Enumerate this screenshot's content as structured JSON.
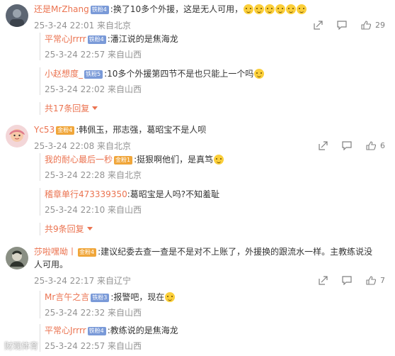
{
  "comments": [
    {
      "user": "还是MrZhang",
      "badge": "铁粉4",
      "text": ":换了10多个外援，这是无人可用，",
      "meta": "25-3-24 22:01 来自北京",
      "like_count": "29",
      "replies": [
        {
          "user": "平常心Jrrrr",
          "badge": "铁粉4",
          "text": ":潘江说的是焦海龙",
          "meta": "25-3-24 22:57 来自山西"
        },
        {
          "user": "小赵想度_",
          "badge": "铁粉5",
          "text": ":10多个外援第四节不是也只能上一个吗",
          "meta": "25-3-24 22:02 来自山西"
        }
      ],
      "more_label": "共17条回复"
    },
    {
      "user": "Yc53",
      "badge": "金粉4",
      "text": ":韩佩玉，邢志强，葛昭宝不是人呗",
      "meta": "25-3-24 22:08 来自北京",
      "like_count": "6",
      "replies": [
        {
          "user": "我的耐心最后一秒",
          "badge": "金粉1",
          "text": ":挺狠啊他们，是真笃",
          "meta": "25-3-24 22:28 来自北京"
        },
        {
          "user": "稽章单行473339350",
          "badge": "",
          "text": ":葛昭宝是人吗?不知羞耻",
          "meta": "25-3-24 22:10 来自山西"
        }
      ],
      "more_label": "共9条回复"
    },
    {
      "user": "莎啦嘿呦丨",
      "badge": "金粉4",
      "text": ":建议纪委去查一查是不是对不上账了，外援换的跟流水一样。主教练说没人可用。",
      "meta": "25-3-24 22:17 来自辽宁",
      "like_count": "7",
      "replies": [
        {
          "user": "Mr言午之言",
          "badge": "铁粉3",
          "text": ":报警吧，现在",
          "meta": "25-3-24 22:32 来自山西"
        },
        {
          "user": "平常心Jrrrr",
          "badge": "铁粉4",
          "text": ":教练说的是焦海龙",
          "meta": "25-3-24 22:57 来自山西"
        }
      ]
    }
  ],
  "watermark": "财观体育",
  "colors": {
    "username": "#eb7350",
    "meta": "#939393",
    "badge_blue": "#7a9ad8",
    "badge_gold": "#f0a63a"
  },
  "icons": [
    "share-icon",
    "comment-icon",
    "like-icon",
    "emoji-icon"
  ]
}
